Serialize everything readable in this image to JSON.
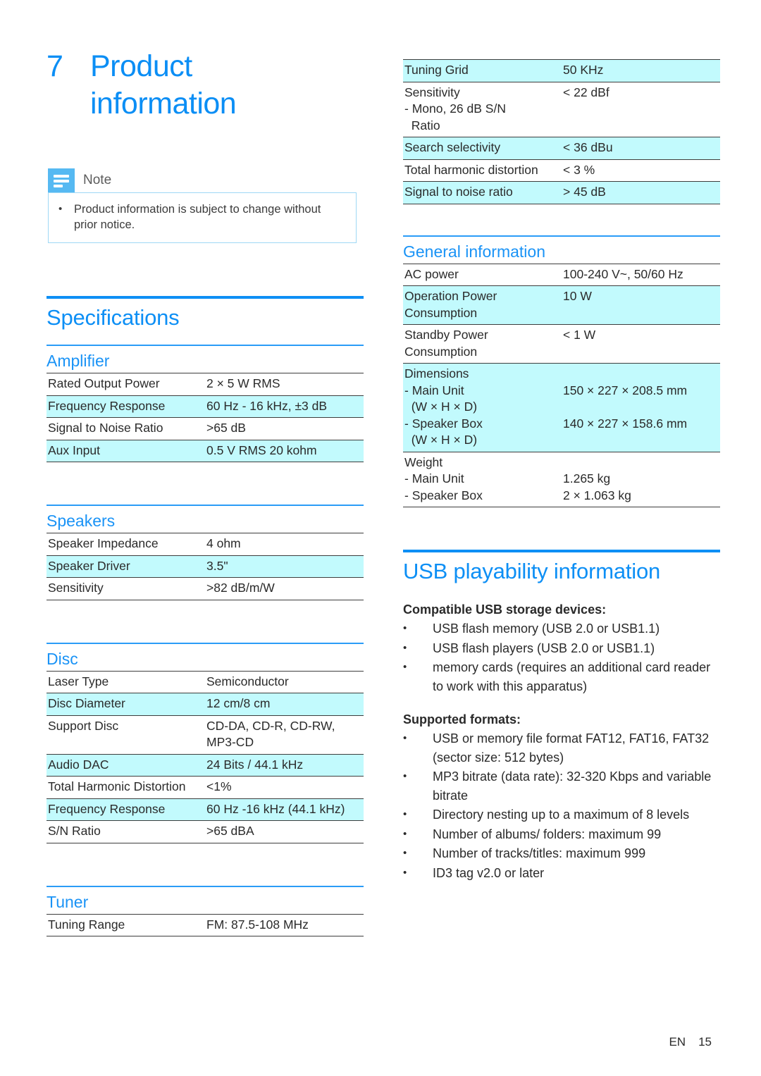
{
  "chapter": {
    "number": "7",
    "title": "Product information"
  },
  "note": {
    "icon": "note-icon",
    "label": "Note",
    "bullet": "•",
    "items": [
      "Product information is subject to change without prior notice."
    ]
  },
  "sections": {
    "specifications": "Specifications",
    "general_information": "General information",
    "usb_playability": "USB playability information"
  },
  "subsections": {
    "amplifier": "Amplifier",
    "speakers": "Speakers",
    "disc": "Disc",
    "tuner": "Tuner"
  },
  "tables": {
    "amplifier": [
      {
        "k": "Rated Output Power",
        "v": "2 × 5 W RMS",
        "hl": false
      },
      {
        "k": "Frequency Response",
        "v": "60 Hz - 16 kHz, ±3 dB",
        "hl": true
      },
      {
        "k": "Signal to Noise Ratio",
        "v": ">65 dB",
        "hl": false
      },
      {
        "k": "Aux Input",
        "v": "0.5 V RMS 20 kohm",
        "hl": true
      }
    ],
    "speakers": [
      {
        "k": "Speaker Impedance",
        "v": "4 ohm",
        "hl": false
      },
      {
        "k": "Speaker Driver",
        "v": "3.5\"",
        "hl": true
      },
      {
        "k": "Sensitivity",
        "v": ">82 dB/m/W",
        "hl": false
      }
    ],
    "disc": [
      {
        "k": "Laser Type",
        "v": "Semiconductor",
        "hl": false
      },
      {
        "k": "Disc Diameter",
        "v": "12 cm/8 cm",
        "hl": true
      },
      {
        "k": "Support Disc",
        "v": "CD-DA, CD-R, CD-RW, MP3-CD",
        "hl": false
      },
      {
        "k": "Audio DAC",
        "v": "24 Bits / 44.1 kHz",
        "hl": true
      },
      {
        "k": "Total Harmonic Distortion",
        "v": "<1%",
        "hl": false
      },
      {
        "k": "Frequency Response",
        "v": "60 Hz -16 kHz (44.1 kHz)",
        "hl": true
      },
      {
        "k": "S/N Ratio",
        "v": ">65 dBA",
        "hl": false
      }
    ],
    "tuner_left": [
      {
        "k": "Tuning Range",
        "v": "FM: 87.5-108 MHz",
        "hl": false
      }
    ],
    "tuner_right": [
      {
        "k": "Tuning Grid",
        "v": "50 KHz",
        "hl": true
      },
      {
        "k": "Sensitivity\n- Mono, 26 dB S/N\n  Ratio",
        "v": "< 22 dBf",
        "hl": false
      },
      {
        "k": "Search selectivity",
        "v": "< 36 dBu",
        "hl": true
      },
      {
        "k": "Total harmonic distortion",
        "v": "< 3 %",
        "hl": false
      },
      {
        "k": "Signal to noise ratio",
        "v": "> 45 dB",
        "hl": true
      }
    ],
    "general": [
      {
        "k": "AC power",
        "v": "100-240 V~, 50/60 Hz",
        "hl": false
      },
      {
        "k": "Operation Power Consumption",
        "v": "10 W",
        "hl": true
      },
      {
        "k": "Standby Power Consumption",
        "v": "< 1 W",
        "hl": false
      },
      {
        "k": "Dimensions\n- Main Unit\n  (W × H × D)\n- Speaker Box\n  (W × H × D)",
        "v": "\n150 × 227 × 208.5 mm\n\n140 × 227 × 158.6 mm",
        "hl": true
      },
      {
        "k": "Weight\n- Main Unit\n- Speaker Box",
        "v": "\n1.265 kg\n2 × 1.063 kg",
        "hl": false
      }
    ]
  },
  "usb": {
    "compatible_heading": "Compatible USB storage devices:",
    "compatible_items": [
      "USB flash memory (USB 2.0 or USB1.1)",
      "USB flash players (USB 2.0 or USB1.1)",
      "memory cards (requires an additional card reader to work with this apparatus)"
    ],
    "formats_heading": "Supported formats:",
    "formats_items": [
      "USB or memory file format FAT12, FAT16, FAT32 (sector size: 512 bytes)",
      "MP3 bitrate (data rate): 32-320 Kbps and variable bitrate",
      "Directory nesting up to a maximum of 8 levels",
      "Number of albums/ folders: maximum 99",
      "Number of tracks/titles: maximum 999",
      "ID3 tag v2.0 or later"
    ],
    "bullet": "•"
  },
  "footer": {
    "language": "EN",
    "page": "15"
  },
  "colors": {
    "accent_blue": "#0d8ff5",
    "highlight_cyan": "#c2fafd",
    "note_icon_blue": "#56b9f2",
    "note_border": "#9fd8f5"
  }
}
